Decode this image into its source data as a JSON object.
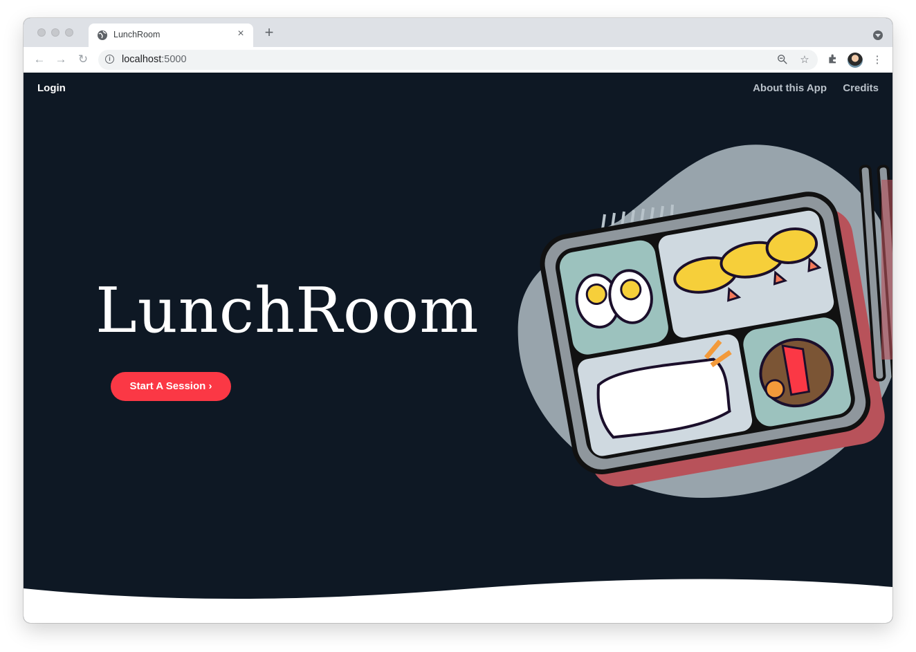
{
  "browser": {
    "tab_title": "LunchRoom",
    "tab_close": "×",
    "new_tab": "+",
    "url_host": "localhost",
    "url_port": ":5000"
  },
  "nav": {
    "login": "Login",
    "about": "About this App",
    "credits": "Credits"
  },
  "hero": {
    "title": "LunchRoom",
    "cta_label": "Start A Session",
    "cta_chevron": "›"
  },
  "colors": {
    "background": "#0e1824",
    "accent": "#fb3845",
    "blob": "#98a4ac"
  }
}
